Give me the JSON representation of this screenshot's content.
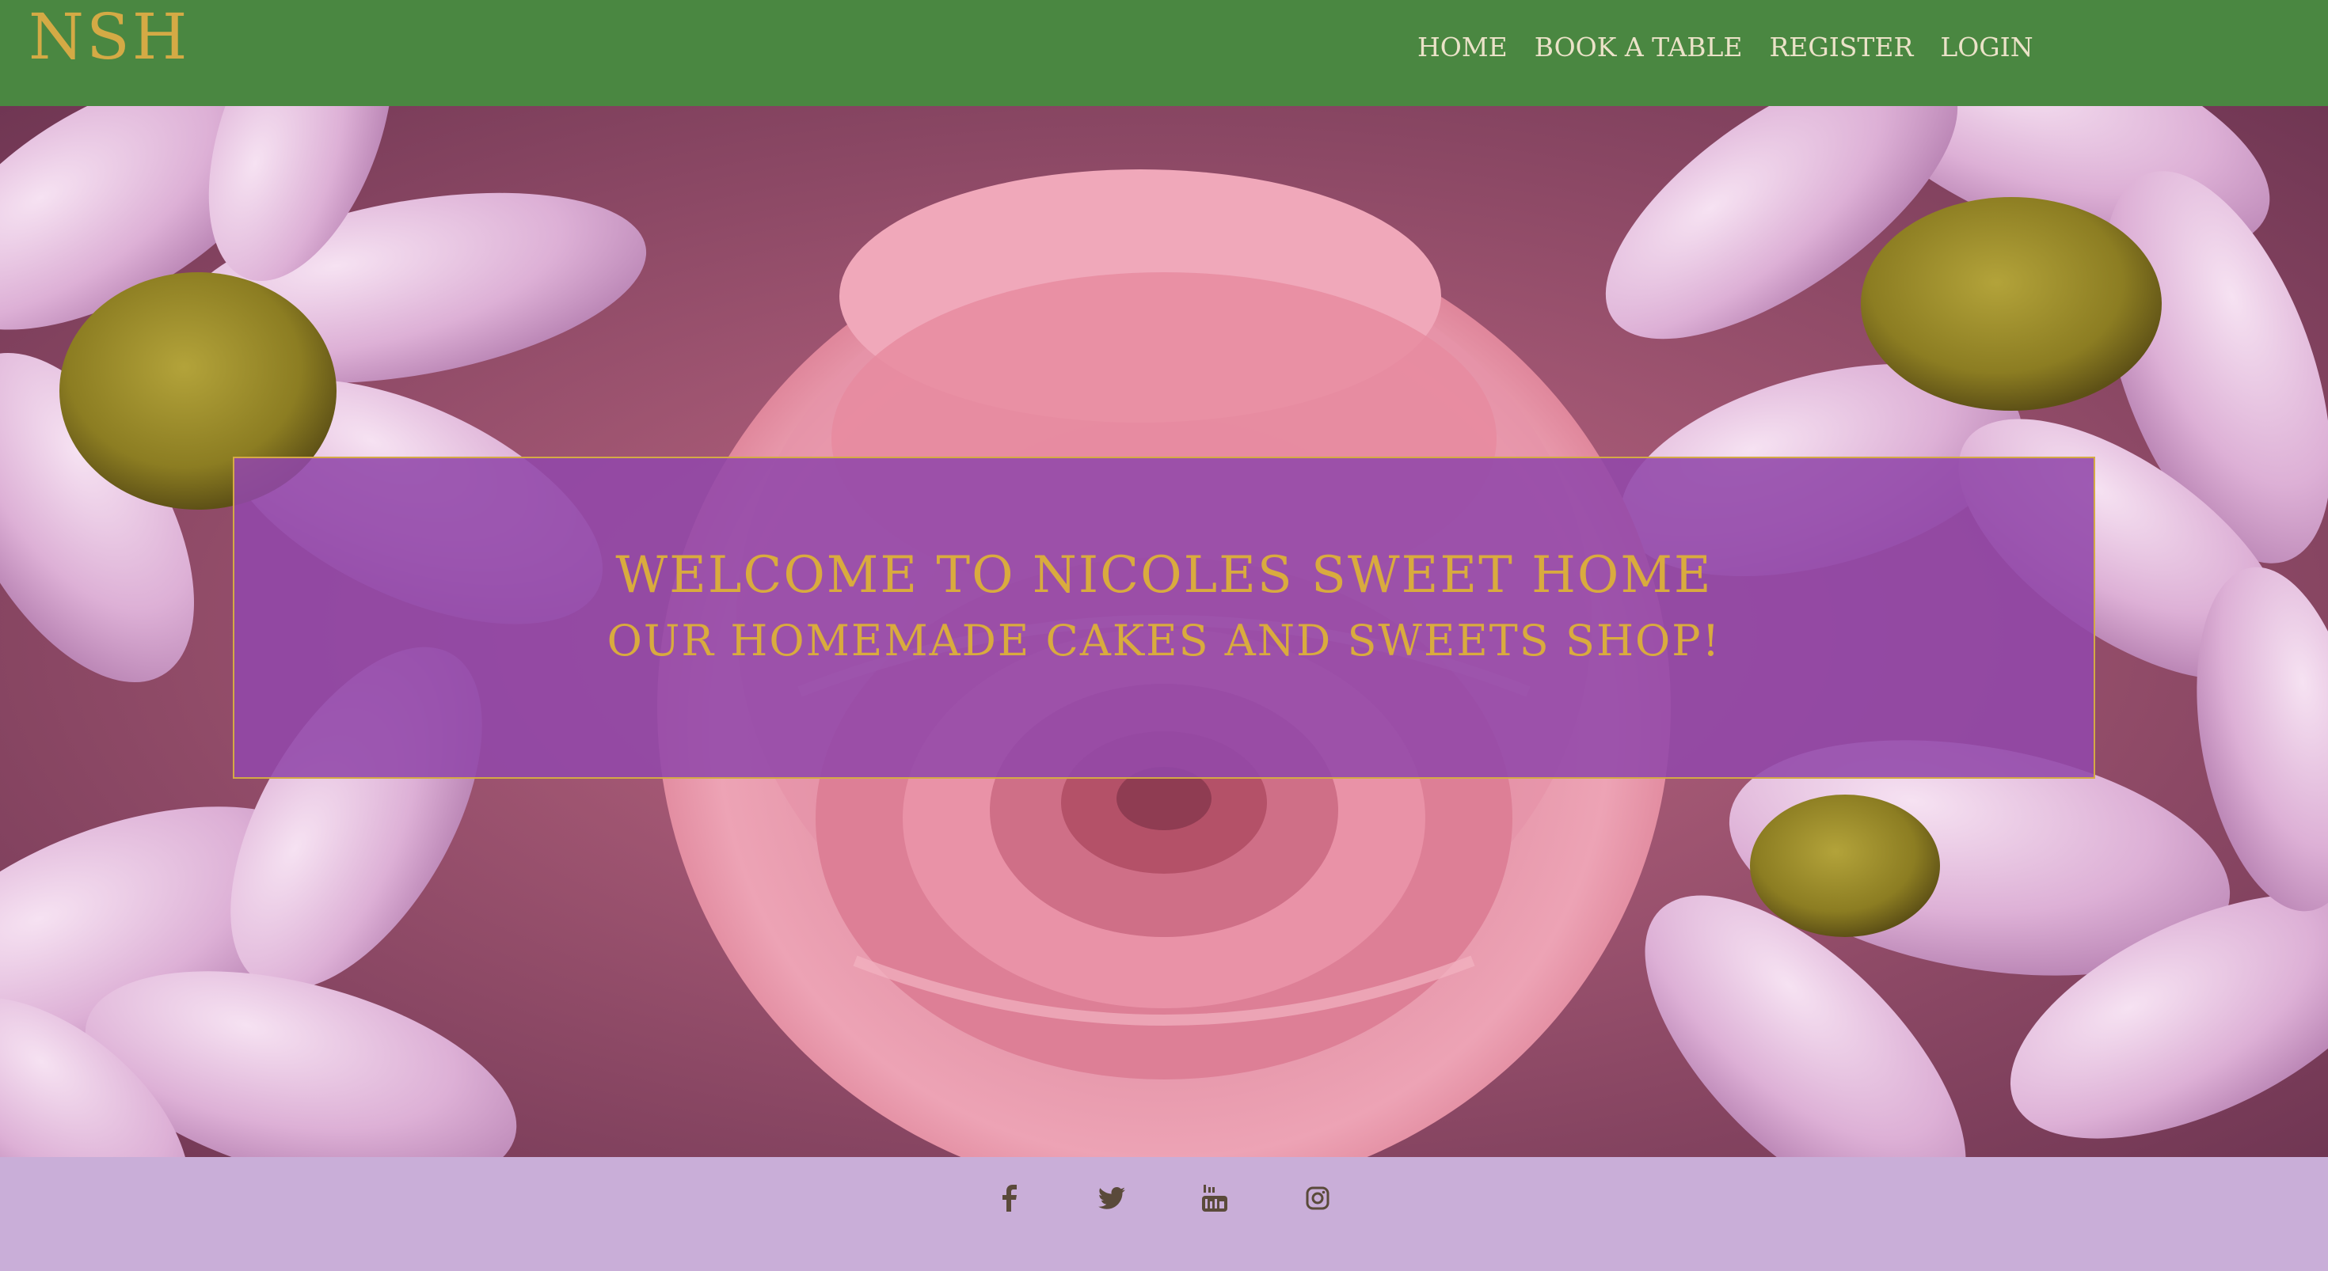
{
  "brand": {
    "name": "NSH"
  },
  "nav": {
    "items": [
      {
        "label": "HOME"
      },
      {
        "label": "BOOK A TABLE"
      },
      {
        "label": "REGISTER"
      },
      {
        "label": "LOGIN"
      }
    ]
  },
  "hero": {
    "welcome_line1": "WELCOME TO NICOLES SWEET HOME",
    "welcome_line2": "OUR HOMEMADE CAKES AND SWEETS SHOP!",
    "background_image": "pink-rose-and-daisies-photo"
  },
  "footer": {
    "social": [
      {
        "icon": "facebook-icon"
      },
      {
        "icon": "twitter-icon"
      },
      {
        "icon": "youtube-icon"
      },
      {
        "icon": "instagram-icon"
      }
    ]
  },
  "colors": {
    "navbar": "#4a8741",
    "gold": "#d4aa45",
    "nav_text": "#ebe2c8",
    "overlay": "#9248aa",
    "footer": "#c9aed8",
    "footer_icons": "#5a4a3a"
  }
}
